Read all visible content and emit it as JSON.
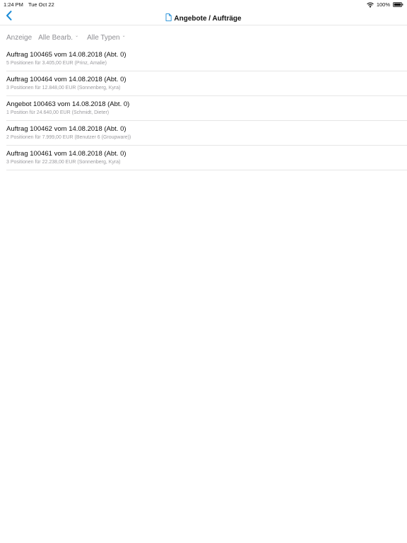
{
  "status_bar": {
    "time": "1:24 PM",
    "date": "Tue Oct 22",
    "battery": "100%"
  },
  "nav": {
    "title": "Angebote / Aufträge",
    "back_icon": "chevron-left-icon",
    "title_icon": "document-icon"
  },
  "filter": {
    "label": "Anzeige",
    "editor": "Alle Bearb.",
    "type": "Alle Typen"
  },
  "orders": [
    {
      "title": "Auftrag 100465 vom 14.08.2018 (Abt. 0)",
      "subtitle": "5 Positionen für 3.405,00 EUR (Prinz, Amalie)"
    },
    {
      "title": "Auftrag 100464 vom 14.08.2018 (Abt. 0)",
      "subtitle": "3 Positionen für 12.848,00 EUR (Sonnenberg, Kyra)"
    },
    {
      "title": "Angebot 100463 vom 14.08.2018 (Abt. 0)",
      "subtitle": "1 Position für 24.640,00 EUR (Schmidt, Dieter)"
    },
    {
      "title": "Auftrag 100462 vom 14.08.2018 (Abt. 0)",
      "subtitle": "2 Positionen für 7.999,00 EUR (Benutzer 6 (Groupware))"
    },
    {
      "title": "Auftrag 100461 vom 14.08.2018 (Abt. 0)",
      "subtitle": "3 Positionen für 22.238,00 EUR (Sonnenberg, Kyra)"
    }
  ],
  "colors": {
    "accent": "#1a8bd6",
    "secondary_text": "#9a9a9e",
    "divider": "#e6e6e6"
  }
}
